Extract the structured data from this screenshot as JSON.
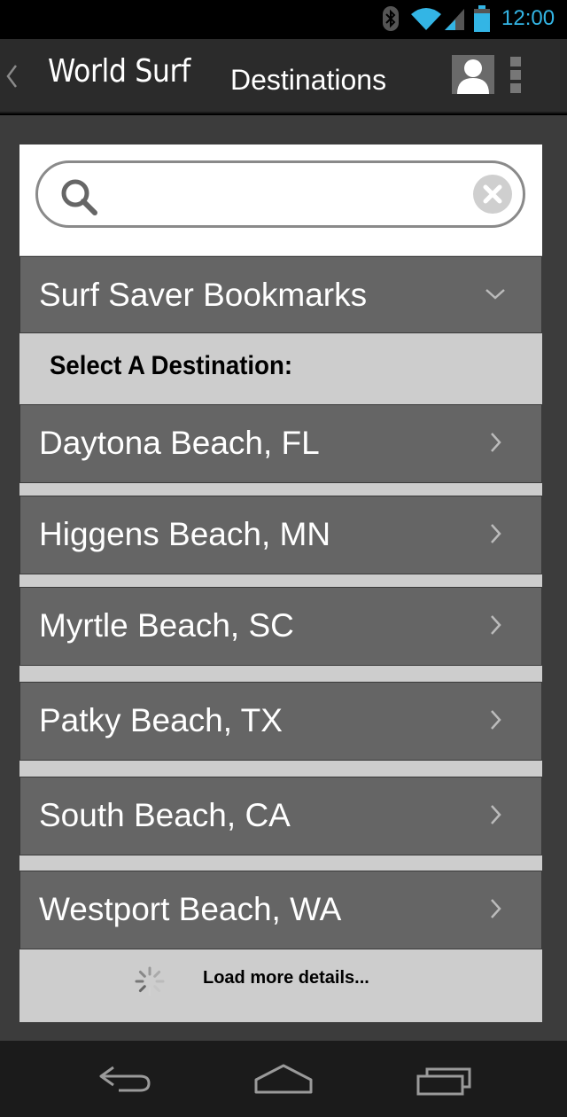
{
  "status_bar": {
    "time": "12:00",
    "accent_color": "#33b5e5",
    "icons": [
      "bluetooth-icon",
      "wifi-icon",
      "signal-icon",
      "battery-icon"
    ]
  },
  "action_bar": {
    "app_title": "World Surf",
    "screen_title": "Destinations",
    "icons": [
      "back-icon",
      "profile-icon",
      "overflow-menu-icon"
    ]
  },
  "search": {
    "value": "",
    "placeholder": ""
  },
  "bookmarks": {
    "label": "Surf Saver Bookmarks"
  },
  "section": {
    "title": "Select A Destination:"
  },
  "destinations": [
    "Daytona Beach, FL",
    "Higgens Beach, MN",
    "Myrtle Beach, SC",
    "Patky Beach, TX",
    "South Beach, CA",
    "Westport Beach, WA"
  ],
  "load_more": {
    "label": "Load more details..."
  },
  "nav_bar": {
    "icons": [
      "back-nav-icon",
      "home-nav-icon",
      "recent-apps-icon"
    ]
  }
}
